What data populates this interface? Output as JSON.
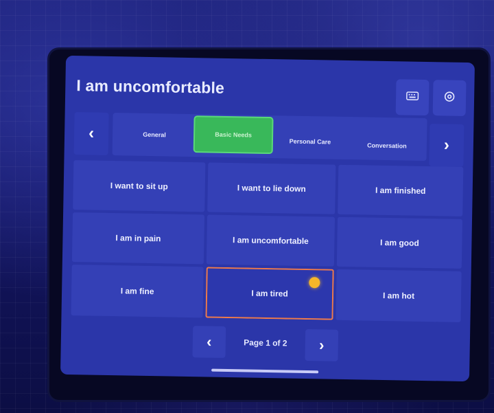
{
  "header": {
    "title": "I am uncomfortable",
    "keyboard_icon": "keyboard-icon",
    "settings_icon": "gear-icon"
  },
  "tabs": {
    "prev_arrow": "‹",
    "next_arrow": "›",
    "items": [
      {
        "label": "General",
        "active": false
      },
      {
        "label": "Basic Needs",
        "active": true
      },
      {
        "label": "Personal Care",
        "active": false
      },
      {
        "label": "Conversation",
        "active": false
      }
    ]
  },
  "phrases": [
    {
      "label": "I want to sit up",
      "selected": false
    },
    {
      "label": "I want to lie down",
      "selected": false
    },
    {
      "label": "I am finished",
      "selected": false
    },
    {
      "label": "I am in pain",
      "selected": false
    },
    {
      "label": "I am uncomfortable",
      "selected": false
    },
    {
      "label": "I am good",
      "selected": false
    },
    {
      "label": "I am fine",
      "selected": false
    },
    {
      "label": "I am tired",
      "selected": true
    },
    {
      "label": "I am hot",
      "selected": false
    }
  ],
  "pager": {
    "prev_arrow": "‹",
    "next_arrow": "›",
    "label": "Page 1 of 2"
  },
  "colors": {
    "panel": "#2b36a9",
    "active_tab": "#39b85a",
    "selection_outline": "#f07b4a",
    "gaze_cursor": "#f6b62a"
  }
}
